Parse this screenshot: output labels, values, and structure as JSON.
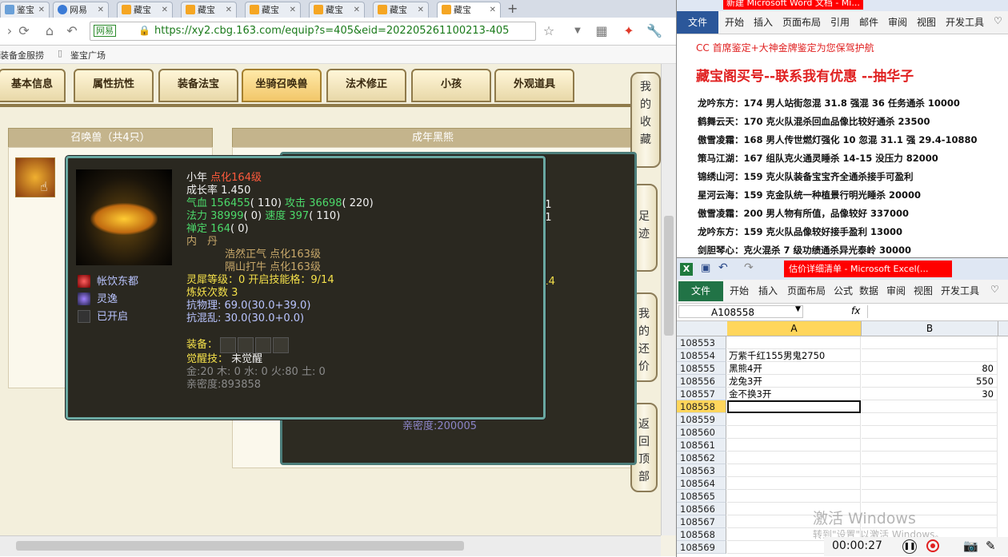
{
  "browser": {
    "tabs": [
      {
        "label": "鉴宝",
        "active": false
      },
      {
        "label": "网易",
        "active": false
      },
      {
        "label": "藏宝",
        "active": false
      },
      {
        "label": "藏宝",
        "active": false
      },
      {
        "label": "藏宝",
        "active": false
      },
      {
        "label": "藏宝",
        "active": false
      },
      {
        "label": "藏宝",
        "active": false
      },
      {
        "label": "藏宝",
        "active": true
      }
    ],
    "url_badge": "网易",
    "url": "https://xy2.cbg.163.com/equip?s=405&eid=202205261100213-405",
    "bookmarks": [
      "装备金服捞",
      "鉴宝广场"
    ]
  },
  "page": {
    "tabs": [
      "基本信息",
      "属性抗性",
      "装备法宝",
      "坐骑召唤兽",
      "法术修正",
      "小孩",
      "外观道具"
    ],
    "selected_tab": "坐骑召唤兽",
    "left_panel_title": "召唤兽（共4只）",
    "right_panel_title": "成年黑熊",
    "side_buttons": [
      "我的收藏",
      "足迹",
      "我的还价",
      "返回顶部"
    ],
    "bg_fragments": [
      "21",
      "01",
      "/14",
      "亲密度:200005"
    ]
  },
  "pet_popup": {
    "name": "小年",
    "level": "点化164级",
    "growth": "成长率 1.450",
    "hp_label": "气血",
    "hp": "156455",
    "hp_extra": "( 110)",
    "atk_label": "攻击",
    "atk": "36698",
    "atk_extra": "( 220)",
    "mp_label": "法力",
    "mp": "38999",
    "mp_extra": "( 0)",
    "spd_label": "速度",
    "spd": "397",
    "spd_extra": "( 110)",
    "zen_label": "禅定",
    "zen": "164",
    "zen_extra": "( 0)",
    "neidan_label": "内　丹",
    "neidan": [
      "浩然正气 点化163级",
      "隔山打牛 点化163级"
    ],
    "lingxi": "灵犀等级：0 开启技能格：9/14",
    "lianyao": "炼妖次数 3",
    "resist_phys": "抗物理: 69.0(30.0+39.0)",
    "resist_chaos": "抗混乱: 30.0(30.0+0.0)",
    "equip_label": "装备：",
    "awaken_label": "觉醒技：",
    "awaken_value": "未觉醒",
    "elements": "金:20 木: 0 水: 0 火:80 土: 0",
    "intimacy": "亲密度:893858",
    "skills": [
      "帐饮东都",
      "灵逸",
      "已开启"
    ],
    "colors": {
      "bg": "#2a2820",
      "border": "#6aa8a1",
      "level": "#ff5a3c",
      "stat": "#4cd96a",
      "highlight": "#f4e04a"
    }
  },
  "word": {
    "title": "新建 Microsoft Word 文档 - Mi...",
    "file_label": "文件",
    "ribbon": [
      "开始",
      "插入",
      "页面布局",
      "引用",
      "邮件",
      "审阅",
      "视图",
      "开发工具"
    ],
    "header_line": "CC 首席鉴定+大神金牌鉴定为您保驾护航",
    "headline": "藏宝阁买号--联系我有优惠 --抽华子",
    "lines": [
      "龙吟东方：174 男人站街忽混 31.8 强混 36 任务通杀 10000",
      "鹤舞云天：170 克火队混杀回血品像比较好通杀 23500",
      "傲雪凌霜：168 男人传世燃灯强化 10 忽混 31.1 强 29.4-10880",
      "策马江湖：167 组队克火通灵睡杀 14-15 没压力 82000",
      "锦绣山河：159 克火队装备宝宝齐全通杀接手可盈利",
      "星河云海：159 克金队统一种植景行明光睡杀 20000",
      "傲雪凌霜：200 男人物有所值，品像较好 337000",
      "龙吟东方：159 克火队品像较好接手盈利 13000",
      "剑胆琴心：克火混杀 7 级功绩通杀异光泰岭 30000"
    ]
  },
  "excel": {
    "title": "估价详细清单 - Microsoft Excel(...",
    "file_label": "文件",
    "ribbon": [
      "开始",
      "插入",
      "页面布局",
      "公式",
      "数据",
      "审阅",
      "视图",
      "开发工具"
    ],
    "name_box": "A108558",
    "fx": "fx",
    "col_headers": [
      "A",
      "B"
    ],
    "rows": [
      {
        "num": "108553",
        "a": "",
        "b": ""
      },
      {
        "num": "108554",
        "a": "万紫千红155男鬼2750",
        "b": ""
      },
      {
        "num": "108555",
        "a": "黑熊4开",
        "b": "80"
      },
      {
        "num": "108556",
        "a": "龙兔3开",
        "b": "550"
      },
      {
        "num": "108557",
        "a": "金不换3开",
        "b": "30"
      },
      {
        "num": "108558",
        "a": "",
        "b": ""
      },
      {
        "num": "108559",
        "a": "",
        "b": ""
      },
      {
        "num": "108560",
        "a": "",
        "b": ""
      },
      {
        "num": "108561",
        "a": "",
        "b": ""
      },
      {
        "num": "108562",
        "a": "",
        "b": ""
      },
      {
        "num": "108563",
        "a": "",
        "b": ""
      },
      {
        "num": "108564",
        "a": "",
        "b": ""
      },
      {
        "num": "108565",
        "a": "",
        "b": ""
      },
      {
        "num": "108566",
        "a": "",
        "b": ""
      },
      {
        "num": "108567",
        "a": "",
        "b": ""
      },
      {
        "num": "108568",
        "a": "",
        "b": ""
      },
      {
        "num": "108569",
        "a": "",
        "b": ""
      }
    ],
    "selected_row": "108558"
  },
  "watermark": {
    "line1": "激活 Windows",
    "line2": "转到\"设置\"以激活 Windows。"
  },
  "recorder": {
    "time": "00:00:27"
  }
}
